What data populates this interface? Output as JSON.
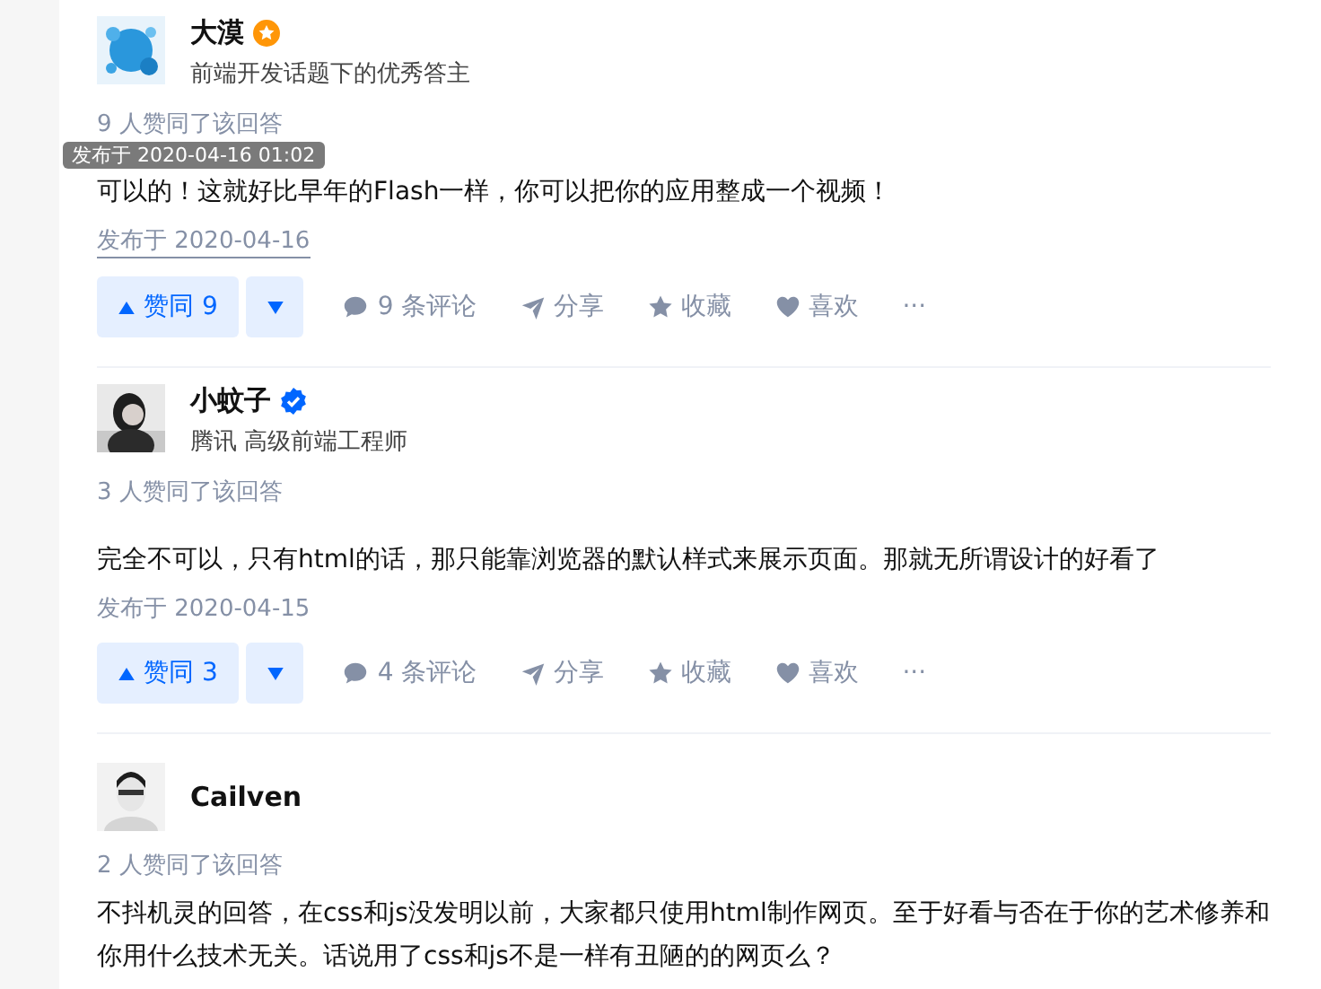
{
  "answers": [
    {
      "author": "大漠",
      "badge": {
        "kind": "star"
      },
      "headline": "前端开发话题下的优秀答主",
      "votes_text": "9 人赞同了该回答",
      "content": "可以的！这就好比早年的Flash一样，你可以把你的应用整成一个视频！",
      "date": "发布于 2020-04-16",
      "date_hovered": true,
      "tooltip": "发布于 2020-04-16 01:02",
      "actions": {
        "upvote": "赞同 9",
        "comments": "9 条评论",
        "share": "分享",
        "collect": "收藏",
        "like": "喜欢",
        "more": "···"
      }
    },
    {
      "author": "小蚊子",
      "badge": {
        "kind": "verified"
      },
      "headline": "腾讯 高级前端工程师",
      "votes_text": "3 人赞同了该回答",
      "content": "完全不可以，只有html的话，那只能靠浏览器的默认样式来展示页面。那就无所谓设计的好看了",
      "date": "发布于 2020-04-15",
      "date_hovered": false,
      "actions": {
        "upvote": "赞同 3",
        "comments": "4 条评论",
        "share": "分享",
        "collect": "收藏",
        "like": "喜欢",
        "more": "···"
      }
    },
    {
      "author": "Cailven",
      "votes_text": "2 人赞同了该回答",
      "content": "不抖机灵的回答，在css和js没发明以前，大家都只使用html制作网页。至于好看与否在于你的艺术修养和你用什么技术无关。话说用了css和js不是一样有丑陋的的网页么？"
    }
  ]
}
